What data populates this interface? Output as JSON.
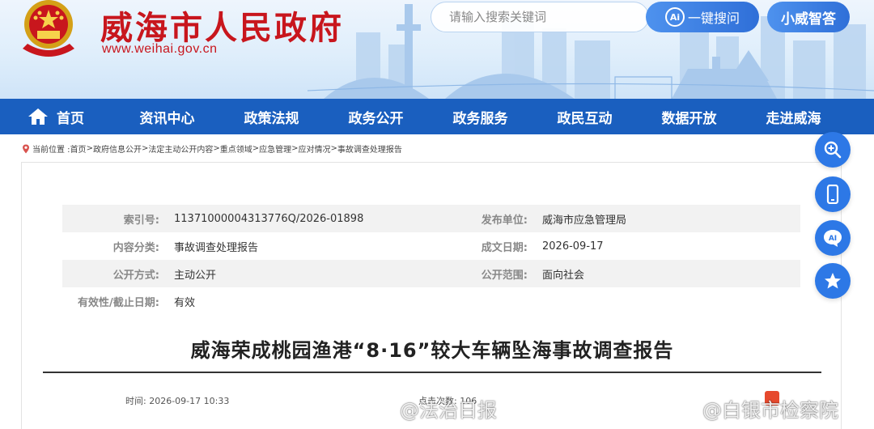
{
  "header": {
    "site_title": "威海市人民政府",
    "site_url": "www.weihai.gov.cn",
    "search_placeholder": "请输入搜索关键词",
    "ai_search_label": "一键搜问",
    "ai_badge": "Ai",
    "xiaowei_label": "小威智答",
    "colors": {
      "brand_red": "#c8161d",
      "nav_blue": "#1a5fbf",
      "button_blue": "#2f6fd8"
    }
  },
  "nav": {
    "items": [
      {
        "label": "首页",
        "icon": "home-icon"
      },
      {
        "label": "资讯中心"
      },
      {
        "label": "政策法规"
      },
      {
        "label": "政务公开"
      },
      {
        "label": "政务服务"
      },
      {
        "label": "政民互动"
      },
      {
        "label": "数据开放"
      },
      {
        "label": "走进威海"
      }
    ]
  },
  "breadcrumb": {
    "prefix": "当前位置 :",
    "items": [
      "首页",
      "政府信息公开",
      "法定主动公开内容",
      "重点领域",
      "应急管理",
      "应对情况",
      "事故调查处理报告"
    ],
    "separator": "> "
  },
  "meta": {
    "index_label": "索引号:",
    "index_value": "11371000004313776Q/2026-01898",
    "publisher_label": "发布单位:",
    "publisher_value": "威海市应急管理局",
    "category_label": "内容分类:",
    "category_value": "事故调查处理报告",
    "date_label": "成文日期:",
    "date_value": "2026-09-17",
    "method_label": "公开方式:",
    "method_value": "主动公开",
    "scope_label": "公开范围:",
    "scope_value": "面向社会",
    "validity_label": "有效性/截止日期:",
    "validity_value": "有效"
  },
  "article": {
    "title": "威海荣成桃园渔港“8·16”较大车辆坠海事故调查报告",
    "time_label": "时间:",
    "time_value": "2026-09-17 10:33",
    "views_label": "点击次数:",
    "views_value": "106"
  },
  "side_buttons": [
    "zoom-in-icon",
    "mobile-icon",
    "ai-chat-icon",
    "favorite-icon"
  ],
  "watermarks": [
    "@法治日报",
    "@白银市检察院"
  ]
}
